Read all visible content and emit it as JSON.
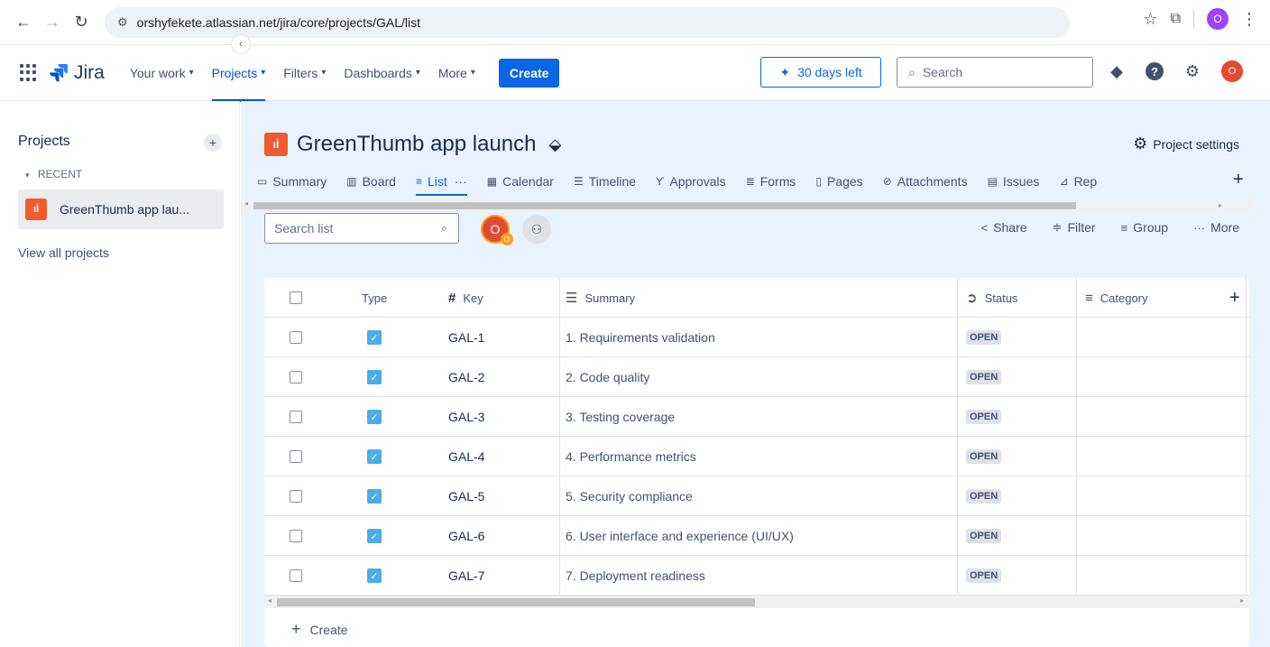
{
  "browser": {
    "url": "orshyfekete.atlassian.net/jira/core/projects/GAL/list",
    "profile_initial": "O"
  },
  "topnav": {
    "logo_text": "Jira",
    "items": [
      {
        "label": "Your work"
      },
      {
        "label": "Projects"
      },
      {
        "label": "Filters"
      },
      {
        "label": "Dashboards"
      },
      {
        "label": "More"
      }
    ],
    "create_label": "Create",
    "trial_label": "30 days left",
    "search_placeholder": "Search",
    "user_initial": "O"
  },
  "sidebar": {
    "title": "Projects",
    "recent_label": "RECENT",
    "project_label": "GreenThumb app lau...",
    "view_all": "View all projects"
  },
  "project": {
    "title": "GreenThumb app launch",
    "settings_label": "Project settings"
  },
  "tabs": [
    {
      "label": "Summary",
      "icon": "summary-icon"
    },
    {
      "label": "Board",
      "icon": "board-icon"
    },
    {
      "label": "List",
      "icon": "list-icon"
    },
    {
      "label": "Calendar",
      "icon": "calendar-icon"
    },
    {
      "label": "Timeline",
      "icon": "timeline-icon"
    },
    {
      "label": "Approvals",
      "icon": "approvals-icon"
    },
    {
      "label": "Forms",
      "icon": "forms-icon"
    },
    {
      "label": "Pages",
      "icon": "pages-icon"
    },
    {
      "label": "Attachments",
      "icon": "attachments-icon"
    },
    {
      "label": "Issues",
      "icon": "issues-icon"
    },
    {
      "label": "Rep",
      "icon": "reports-icon"
    }
  ],
  "toolbar": {
    "search_placeholder": "Search list",
    "avatar_initial": "O",
    "avatar_badge": "O",
    "share_label": "Share",
    "filter_label": "Filter",
    "group_label": "Group",
    "more_label": "More"
  },
  "table": {
    "headers": {
      "type": "Type",
      "key": "Key",
      "summary": "Summary",
      "status": "Status",
      "category": "Category"
    },
    "rows": [
      {
        "key": "GAL-1",
        "summary": "1. Requirements validation",
        "status": "OPEN"
      },
      {
        "key": "GAL-2",
        "summary": "2. Code quality",
        "status": "OPEN"
      },
      {
        "key": "GAL-3",
        "summary": "3. Testing coverage",
        "status": "OPEN"
      },
      {
        "key": "GAL-4",
        "summary": "4. Performance metrics",
        "status": "OPEN"
      },
      {
        "key": "GAL-5",
        "summary": "5. Security compliance",
        "status": "OPEN"
      },
      {
        "key": "GAL-6",
        "summary": "6. User interface and experience (UI/UX)",
        "status": "OPEN"
      },
      {
        "key": "GAL-7",
        "summary": "7. Deployment readiness",
        "status": "OPEN"
      }
    ],
    "create_label": "Create"
  },
  "colors": {
    "accent": "#0c66e4",
    "project_icon": "#f15b2f",
    "main_bg": "#e9f2ff",
    "type_icon": "#4bade8"
  }
}
